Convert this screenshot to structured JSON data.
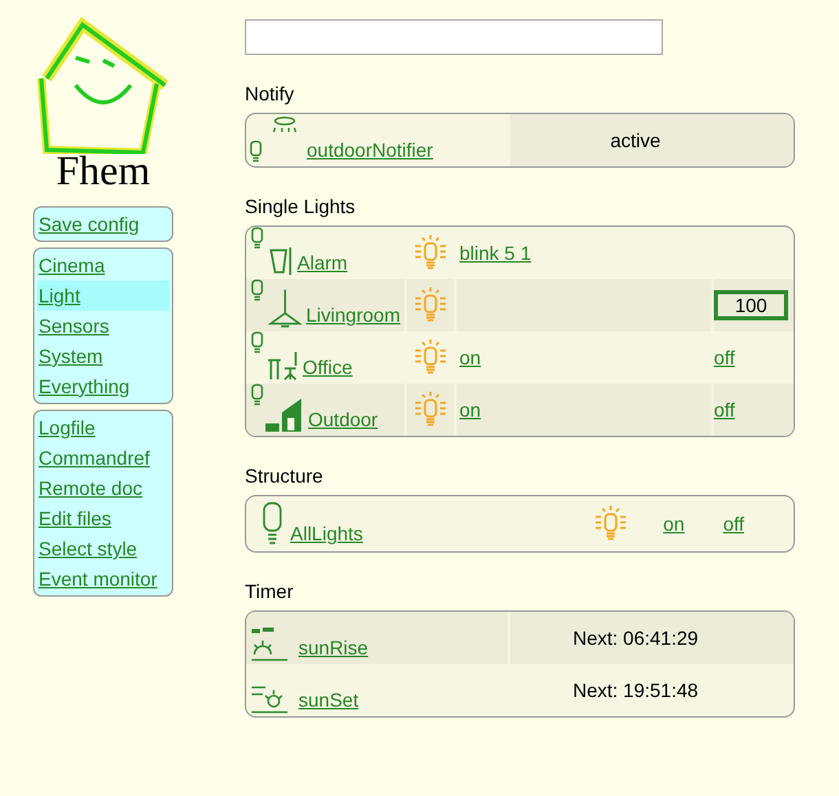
{
  "logo": {
    "title": "Fhem"
  },
  "menu_groups": [
    {
      "items": [
        {
          "label": "Save config",
          "selected": false
        }
      ]
    },
    {
      "items": [
        {
          "label": "Cinema",
          "selected": false
        },
        {
          "label": "Light",
          "selected": true
        },
        {
          "label": "Sensors",
          "selected": false
        },
        {
          "label": "System",
          "selected": false
        },
        {
          "label": "Everything",
          "selected": false
        }
      ]
    },
    {
      "items": [
        {
          "label": "Logfile",
          "selected": false
        },
        {
          "label": "Commandref",
          "selected": false
        },
        {
          "label": "Remote doc",
          "selected": false
        },
        {
          "label": "Edit files",
          "selected": false
        },
        {
          "label": "Select style",
          "selected": false
        },
        {
          "label": "Event monitor",
          "selected": false
        }
      ]
    }
  ],
  "sections": [
    {
      "title": "Notify",
      "kind": "status",
      "rows": [
        {
          "name": "outdoorNotifier",
          "status": "active"
        }
      ]
    },
    {
      "title": "Single Lights",
      "kind": "devices",
      "rows": [
        {
          "name": "Alarm",
          "lit": true,
          "kind": "command",
          "command": "blink 5 1"
        },
        {
          "name": "Livingroom",
          "lit": true,
          "kind": "value",
          "value": "100"
        },
        {
          "name": "Office",
          "lit": true,
          "kind": "switch",
          "on": "on",
          "off": "off"
        },
        {
          "name": "Outdoor",
          "lit": true,
          "kind": "switch",
          "on": "on",
          "off": "off"
        }
      ]
    },
    {
      "title": "Structure",
      "kind": "structure",
      "rows": [
        {
          "name": "AllLights",
          "lit": true,
          "on": "on",
          "off": "off"
        }
      ]
    },
    {
      "title": "Timer",
      "kind": "status",
      "rows": [
        {
          "name": "sunRise",
          "status": "Next: 06:41:29"
        },
        {
          "name": "sunSet",
          "status": "Next: 19:51:48"
        }
      ]
    }
  ]
}
